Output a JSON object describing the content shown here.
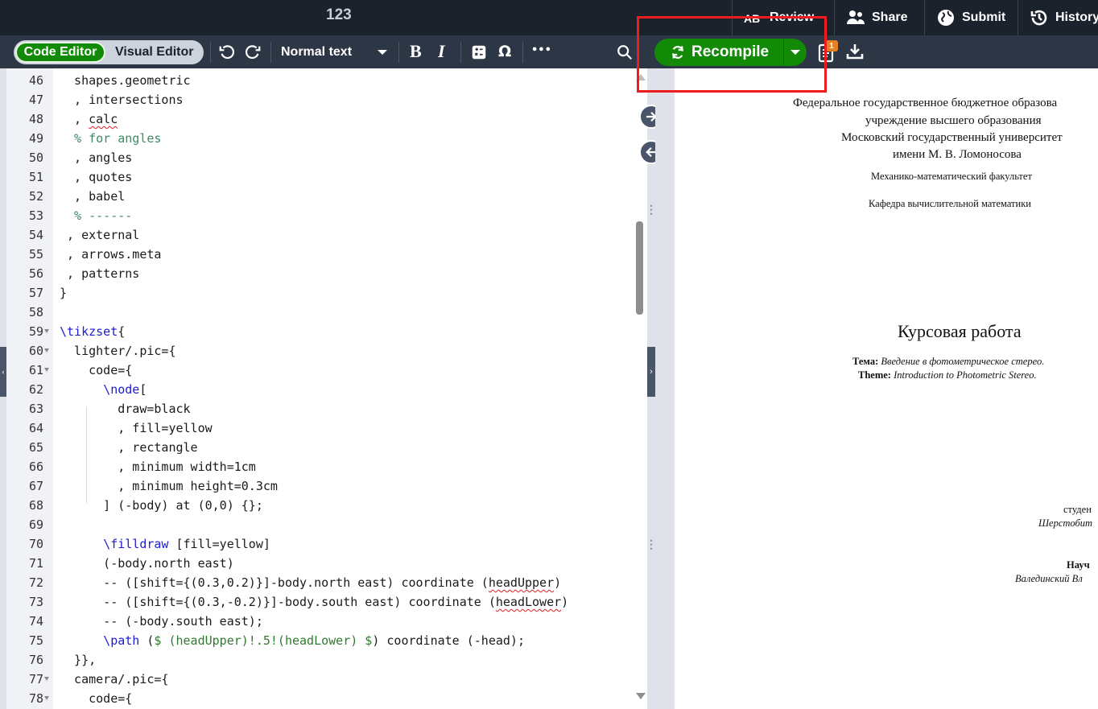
{
  "header": {
    "project_title": "123",
    "buttons": [
      {
        "label": "Review",
        "icon": "review-icon"
      },
      {
        "label": "Share",
        "icon": "users-icon"
      },
      {
        "label": "Submit",
        "icon": "globe-icon"
      },
      {
        "label": "History",
        "icon": "history-icon"
      }
    ]
  },
  "toolbar": {
    "code_editor_label": "Code Editor",
    "visual_editor_label": "Visual Editor",
    "text_style": "Normal text",
    "bold_label": "B",
    "italic_label": "I",
    "omega_label": "Ω",
    "more_label": "•••",
    "recompile_label": "Recompile",
    "log_badge": "1",
    "accent_color": "#138a07"
  },
  "editor": {
    "lines": [
      {
        "n": "46",
        "text": "  shapes.geometric"
      },
      {
        "n": "47",
        "text": "  , intersections"
      },
      {
        "n": "48",
        "text": "  , calc"
      },
      {
        "n": "49",
        "text": "  % for angles"
      },
      {
        "n": "50",
        "text": "  , angles"
      },
      {
        "n": "51",
        "text": "  , quotes"
      },
      {
        "n": "52",
        "text": "  , babel"
      },
      {
        "n": "53",
        "text": "  % ------"
      },
      {
        "n": "54",
        "text": " , external"
      },
      {
        "n": "55",
        "text": " , arrows.meta"
      },
      {
        "n": "56",
        "text": " , patterns"
      },
      {
        "n": "57",
        "text": "}"
      },
      {
        "n": "58",
        "text": ""
      },
      {
        "n": "59",
        "text": "\\tikzset{"
      },
      {
        "n": "60",
        "text": "  lighter/.pic={"
      },
      {
        "n": "61",
        "text": "    code={"
      },
      {
        "n": "62",
        "text": "      \\node["
      },
      {
        "n": "63",
        "text": "        draw=black"
      },
      {
        "n": "64",
        "text": "        , fill=yellow"
      },
      {
        "n": "65",
        "text": "        , rectangle"
      },
      {
        "n": "66",
        "text": "        , minimum width=1cm"
      },
      {
        "n": "67",
        "text": "        , minimum height=0.3cm"
      },
      {
        "n": "68",
        "text": "      ] (-body) at (0,0) {};"
      },
      {
        "n": "69",
        "text": ""
      },
      {
        "n": "70",
        "text": "      \\filldraw [fill=yellow]"
      },
      {
        "n": "71",
        "text": "      (-body.north east)"
      },
      {
        "n": "72",
        "text": "      -- ([shift={(0.3,0.2)}]-body.north east) coordinate (headUpper)"
      },
      {
        "n": "73",
        "text": "      -- ([shift={(0.3,-0.2)}]-body.south east) coordinate (headLower)"
      },
      {
        "n": "74",
        "text": "      -- (-body.south east);"
      },
      {
        "n": "75",
        "text": "      \\path ($ (headUpper)!.5!(headLower) $) coordinate (-head);"
      },
      {
        "n": "76",
        "text": "  }},"
      },
      {
        "n": "77",
        "text": "  camera/.pic={"
      },
      {
        "n": "78",
        "text": "    code={"
      }
    ]
  },
  "pdf": {
    "inst_line1": "Федеральное государственное бюджетное образова",
    "inst_line2": "учреждение высшего образования",
    "inst_line3": "Московский государственный университет",
    "inst_line4": "имени М. В. Ломоносова",
    "faculty": "Механико-математический факультет",
    "department": "Кафедра вычислительной математики",
    "doc_title": "Курсовая работа",
    "topic_label": "Тема:",
    "topic_value": "Введение в фотометрическое стерео.",
    "theme_label": "Theme:",
    "theme_value": "Introduction to Photometric Stereo.",
    "student_label": "студен",
    "student_name": "Шерстобит",
    "advisor_label": "Науч",
    "advisor_name": "Валединский Вл"
  }
}
